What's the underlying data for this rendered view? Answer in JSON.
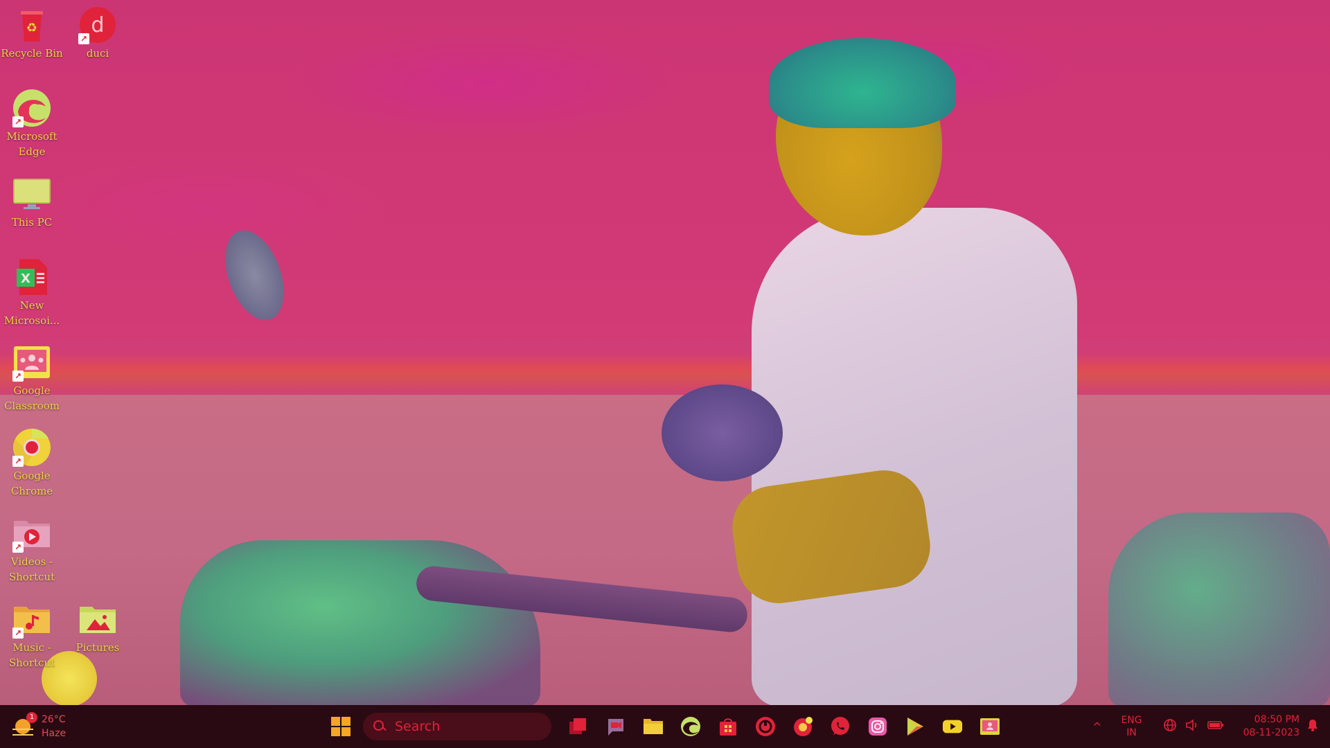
{
  "desktop": {
    "icons": [
      {
        "label": "Recycle Bin",
        "icon": "recycle-bin-icon"
      },
      {
        "label": "duci",
        "icon": "duci-app-icon",
        "letter": "d"
      },
      {
        "label": "Microsoft Edge",
        "icon": "edge-icon"
      },
      {
        "label": "This PC",
        "icon": "monitor-icon"
      },
      {
        "label": "New Microsoi...",
        "icon": "excel-file-icon",
        "letter": "X"
      },
      {
        "label": "Google Classroom",
        "icon": "classroom-icon"
      },
      {
        "label": "Google Chrome",
        "icon": "chrome-icon"
      },
      {
        "label": "Videos - Shortcut",
        "icon": "videos-folder-icon"
      },
      {
        "label": "Music - Shortcut",
        "icon": "music-folder-icon"
      },
      {
        "label": "Pictures",
        "icon": "pictures-folder-icon"
      }
    ]
  },
  "taskbar": {
    "weather": {
      "temp": "26°C",
      "condition": "Haze",
      "badge": "1"
    },
    "search": {
      "placeholder": "Search"
    },
    "apps": [
      {
        "name": "task-view",
        "icon": "task-view-icon"
      },
      {
        "name": "meet",
        "icon": "video-call-icon"
      },
      {
        "name": "file-explorer",
        "icon": "folder-icon"
      },
      {
        "name": "edge",
        "icon": "edge-icon"
      },
      {
        "name": "store",
        "icon": "store-icon"
      },
      {
        "name": "app-red",
        "icon": "circle-app-icon"
      },
      {
        "name": "chrome-canary",
        "icon": "chrome-canary-icon"
      },
      {
        "name": "whatsapp",
        "icon": "whatsapp-icon"
      },
      {
        "name": "instagram",
        "icon": "instagram-icon"
      },
      {
        "name": "play-store",
        "icon": "play-store-icon"
      },
      {
        "name": "youtube",
        "icon": "youtube-icon"
      },
      {
        "name": "classroom",
        "icon": "classroom-icon"
      }
    ],
    "tray": {
      "chevron": "^",
      "lang_line1": "ENG",
      "lang_line2": "IN",
      "network_icon": "network-icon",
      "volume_icon": "volume-icon",
      "battery_icon": "battery-icon",
      "time": "08:50 PM",
      "date": "08-11-2023",
      "notification_icon": "bell-icon"
    }
  },
  "colors": {
    "icon_label": "#e8d24a",
    "taskbar_bg": "#2a0a12",
    "accent": "#e0233a"
  }
}
